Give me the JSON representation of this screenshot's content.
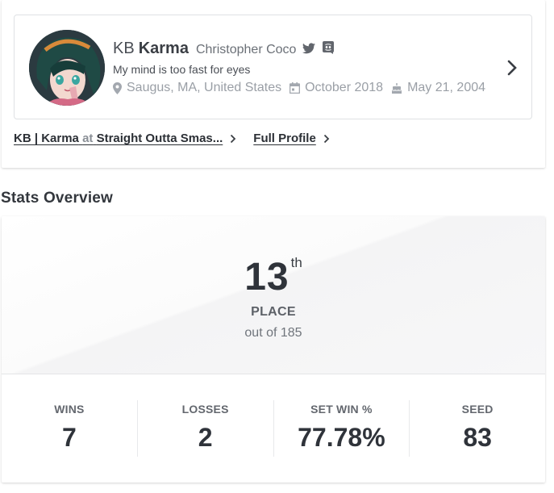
{
  "profile": {
    "prefix": "KB",
    "gamertag": "Karma",
    "real_name": "Christopher Coco",
    "bio": "My mind is too fast for eyes",
    "location": "Saugus, MA, United States",
    "joined": "October 2018",
    "birthday": "May 21, 2004",
    "social_icons": [
      "twitter-icon",
      "discord-icon"
    ]
  },
  "links": {
    "event_gamertag": "KB | Karma",
    "event_at": "at",
    "event_name": "Straight Outta Smas...",
    "full_profile": "Full Profile"
  },
  "stats_overview": {
    "title": "Stats Overview",
    "placement": "13",
    "placement_suffix": "th",
    "place_label": "PLACE",
    "out_of": "out of 185",
    "stats": [
      {
        "label": "WINS",
        "value": "7"
      },
      {
        "label": "LOSSES",
        "value": "2"
      },
      {
        "label": "SET WIN %",
        "value": "77.78%"
      },
      {
        "label": "SEED",
        "value": "83"
      }
    ]
  }
}
